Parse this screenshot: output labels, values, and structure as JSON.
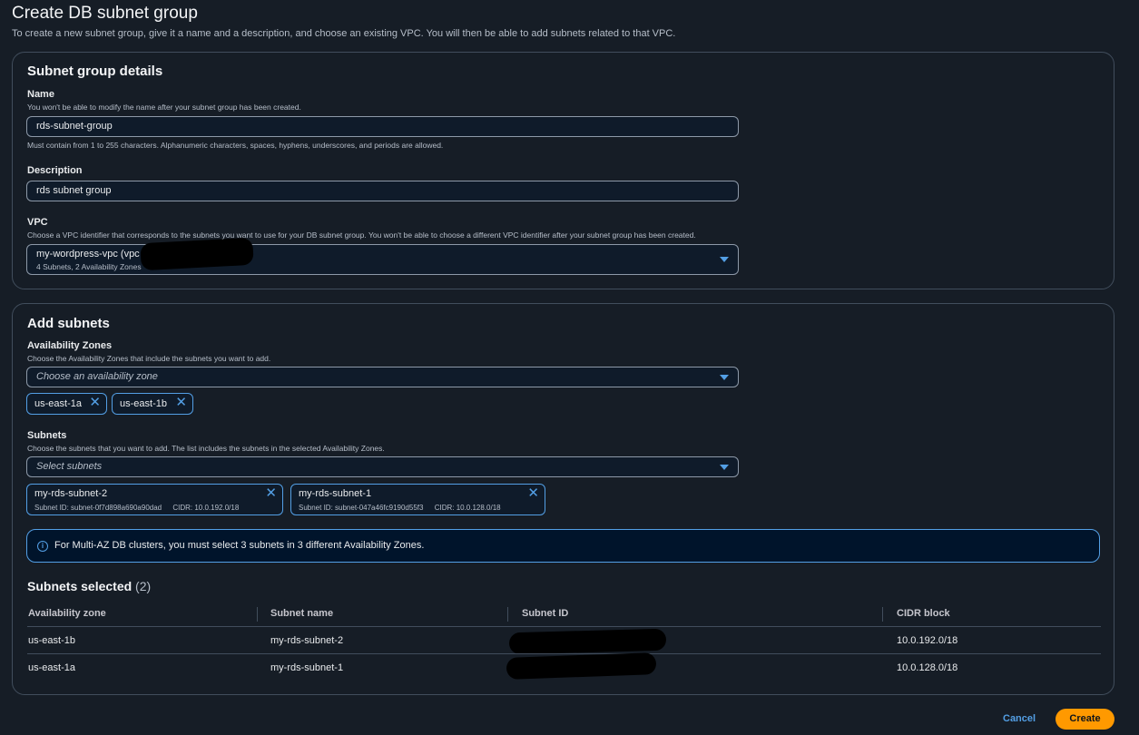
{
  "page": {
    "title": "Create DB subnet group",
    "description": "To create a new subnet group, give it a name and a description, and choose an existing VPC. You will then be able to add subnets related to that VPC."
  },
  "details": {
    "title": "Subnet group details",
    "name_label": "Name",
    "name_hint": "You won't be able to modify the name after your subnet group has been created.",
    "name_value": "rds-subnet-group",
    "name_constraint": "Must contain from 1 to 255 characters. Alphanumeric characters, spaces, hyphens, underscores, and periods are allowed.",
    "description_label": "Description",
    "description_value": "rds subnet group",
    "vpc_label": "VPC",
    "vpc_hint": "Choose a VPC identifier that corresponds to the subnets you want to use for your DB subnet group. You won't be able to choose a different VPC identifier after your subnet group has been created.",
    "vpc_value": "my-wordpress-vpc (vpc",
    "vpc_sub": "4 Subnets, 2 Availability Zones"
  },
  "add_subnets": {
    "title": "Add subnets",
    "az_label": "Availability Zones",
    "az_hint": "Choose the Availability Zones that include the subnets you want to add.",
    "az_placeholder": "Choose an availability zone",
    "az_tokens": [
      "us-east-1a",
      "us-east-1b"
    ],
    "subnets_label": "Subnets",
    "subnets_hint": "Choose the subnets that you want to add. The list includes the subnets in the selected Availability Zones.",
    "subnets_placeholder": "Select subnets",
    "subnet_tokens": [
      {
        "name": "my-rds-subnet-2",
        "id": "Subnet ID: subnet-0f7d898a690a90dad",
        "cidr": "CIDR: 10.0.192.0/18"
      },
      {
        "name": "my-rds-subnet-1",
        "id": "Subnet ID: subnet-047a46fc9190d55f3",
        "cidr": "CIDR: 10.0.128.0/18"
      }
    ],
    "alert_text": "For Multi-AZ DB clusters, you must select 3 subnets in 3 different Availability Zones."
  },
  "selected_table": {
    "title": "Subnets selected",
    "count": "(2)",
    "headers": [
      "Availability zone",
      "Subnet name",
      "Subnet ID",
      "CIDR block"
    ],
    "rows": [
      {
        "az": "us-east-1b",
        "name": "my-rds-subnet-2",
        "id": "",
        "cidr": "10.0.192.0/18"
      },
      {
        "az": "us-east-1a",
        "name": "my-rds-subnet-1",
        "id": "",
        "cidr": "10.0.128.0/18"
      }
    ]
  },
  "actions": {
    "cancel": "Cancel",
    "create": "Create"
  },
  "colors": {
    "background": "#161d26",
    "accent": "#539fe5",
    "primary_button": "#ff9900"
  }
}
